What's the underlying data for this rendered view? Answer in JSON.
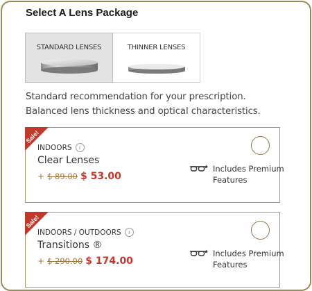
{
  "title": "Select A Lens Package",
  "tabs": [
    {
      "label": "STANDARD LENSES",
      "active": true
    },
    {
      "label": "THINNER LENSES",
      "active": false
    }
  ],
  "description": {
    "line1": "Standard recommendation for your prescription.",
    "line2": "Balanced lens thickness and optical characteristics."
  },
  "packages": [
    {
      "badge": "Sale!",
      "environment": "INDOORS",
      "name": "Clear Lenses",
      "plus": "+",
      "old_price": "$ 89.00",
      "new_price": "$ 53.00",
      "features": "Includes Premium Features",
      "selected": false
    },
    {
      "badge": "Sale!",
      "environment": "INDOORS / OUTDOORS",
      "name": "Transitions ®",
      "plus": "+",
      "old_price": "$ 290.00",
      "new_price": "$ 174.00",
      "features": "Includes Premium Features",
      "selected": false
    }
  ],
  "icons": {
    "info": "info-icon",
    "glasses": "glasses-star-icon"
  },
  "colors": {
    "border": "#9a8a55",
    "sale": "#c0392b",
    "price": "#c0392b",
    "old_price": "#a0793d"
  }
}
